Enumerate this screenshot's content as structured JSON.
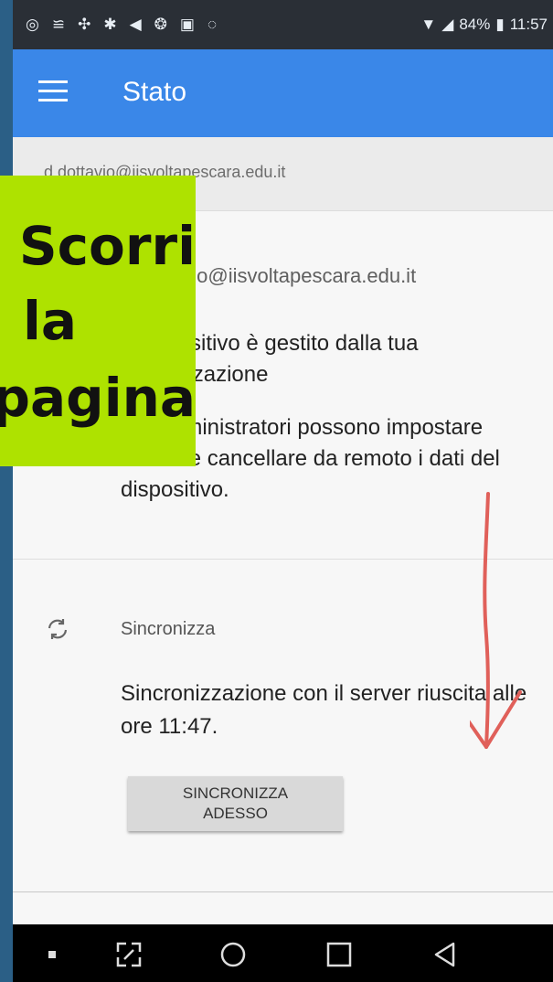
{
  "status_bar": {
    "battery": "84%",
    "time": "11:57"
  },
  "app_bar": {
    "title": "Stato"
  },
  "account": {
    "strip_email": "d.dottavio@iisvoltapescara.edu.it",
    "row_email": "d.dottavio@iisvoltapescara.edu.it"
  },
  "device_info": {
    "managed": "Il dispositivo è gestito dalla tua organizzazione",
    "admins": "Gli amministratori possono impostare norme e cancellare da remoto i dati del dispositivo."
  },
  "sync": {
    "heading": "Sincronizza",
    "status": "Sincronizzazione con il server riuscita alle ore 11:47.",
    "button_line1": "SINCRONIZZA",
    "button_line2": "ADESSO"
  },
  "overlay": {
    "line1": "Scorri",
    "line2": "la",
    "line3": "pagina",
    "color": "#aee200"
  },
  "colors": {
    "app_bar": "#3a87e8",
    "annotation_arrow": "#e0605a"
  }
}
